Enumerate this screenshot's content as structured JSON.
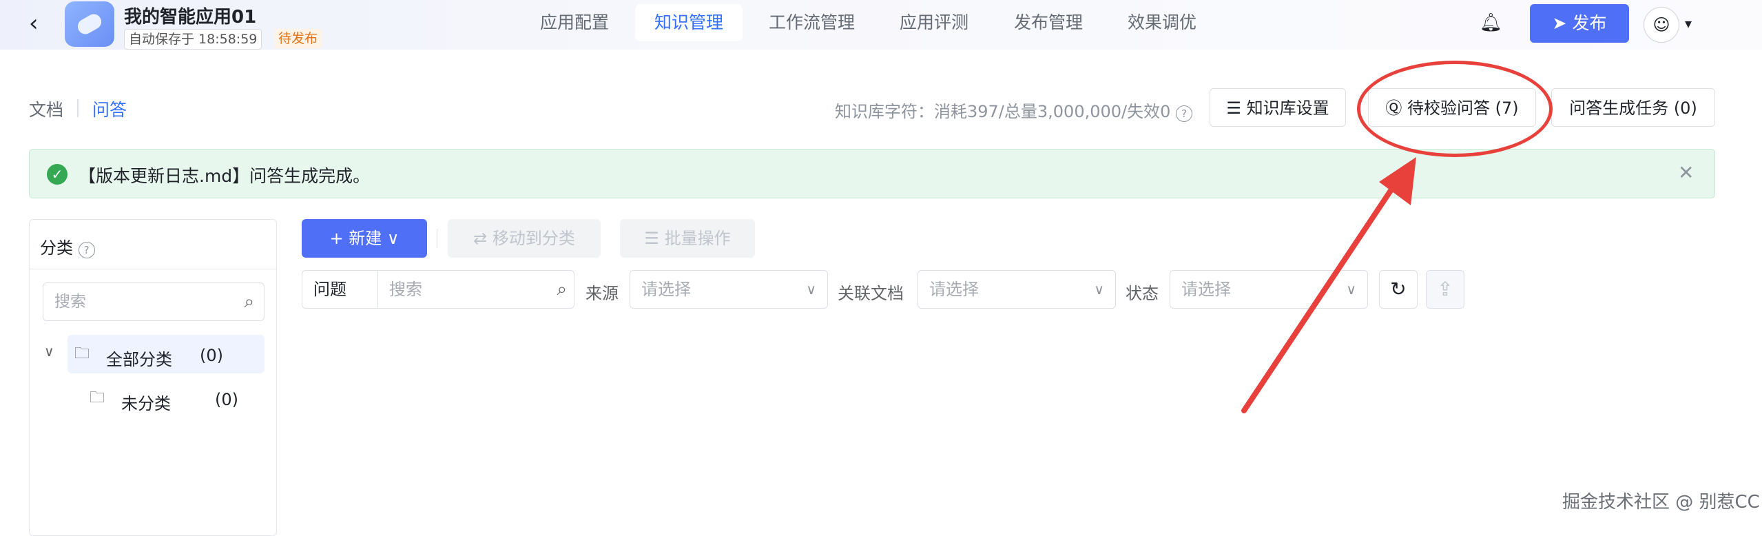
{
  "header": {
    "back_icon": "chevron-left-icon",
    "app_title": "我的智能应用01",
    "autosave": "自动保存于 18:58:59",
    "status": "待发布",
    "tabs": [
      {
        "label": "应用配置",
        "active": false
      },
      {
        "label": "知识管理",
        "active": true
      },
      {
        "label": "工作流管理",
        "active": false
      },
      {
        "label": "应用评测",
        "active": false
      },
      {
        "label": "发布管理",
        "active": false
      },
      {
        "label": "效果调优",
        "active": false
      }
    ],
    "bell_icon": "bell-icon",
    "publish_label": "发布",
    "avatar_icon": "user-icon"
  },
  "subnav": {
    "doc_tab": "文档",
    "qa_tab": "问答",
    "kb_info": "知识库字符：消耗397/总量3,000,000/失效0",
    "kb_settings": "知识库设置",
    "pending_qa": "待校验问答 (7)",
    "qa_tasks": "问答生成任务 (0)"
  },
  "alert": {
    "text": "【版本更新日志.md】问答生成完成。"
  },
  "sidebar": {
    "title": "分类",
    "search_placeholder": "搜索",
    "all_label": "全部分类",
    "all_count": "(0)",
    "uncat_label": "未分类",
    "uncat_count": "(0)"
  },
  "toolbar": {
    "new_label": "新建",
    "move_label": "移动到分类",
    "batch_label": "批量操作"
  },
  "filters": {
    "question_label": "问题",
    "question_placeholder": "搜索",
    "source_label": "来源",
    "source_placeholder": "请选择",
    "doc_label": "关联文档",
    "doc_placeholder": "请选择",
    "status_label": "状态",
    "status_placeholder": "请选择"
  },
  "watermark": "掘金技术社区 @ 别惹CC",
  "colors": {
    "primary": "#4f6ff7",
    "active_tab": "#3370ff",
    "success_bg": "#e8f7ee",
    "pending": "#e37318",
    "annotation": "#e8403a"
  }
}
